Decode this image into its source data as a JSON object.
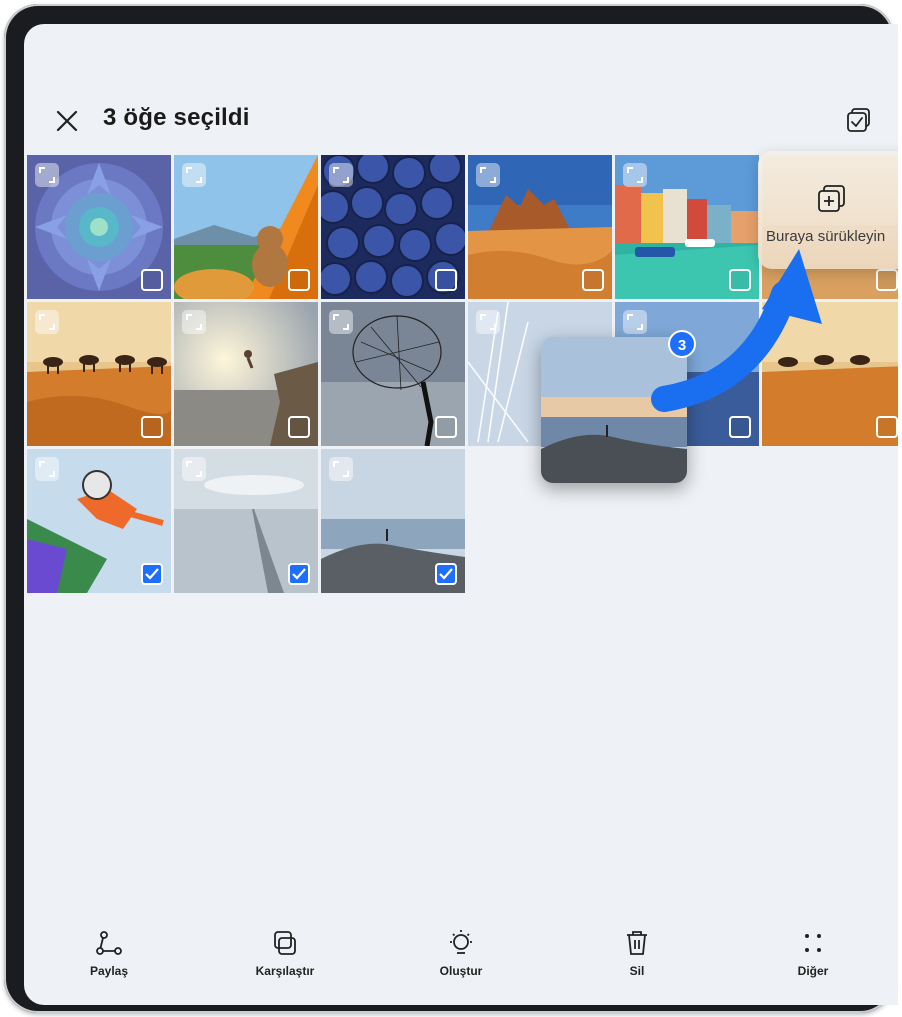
{
  "header": {
    "title": "3 öğe seçildi",
    "close_icon": "close-icon",
    "select_all_icon": "select-all-icon"
  },
  "grid": {
    "tiles": [
      {
        "name": "succulent-photo",
        "selected": false
      },
      {
        "name": "tent-teddy-photo",
        "selected": false
      },
      {
        "name": "blueberries-photo",
        "selected": false
      },
      {
        "name": "desert-rock-photo",
        "selected": false
      },
      {
        "name": "canal-houses-photo",
        "selected": false
      },
      {
        "name": "camel-caravan-photo",
        "selected": false
      },
      {
        "name": "cliff-jump-photo",
        "selected": false
      },
      {
        "name": "fishing-net-photo",
        "selected": false
      },
      {
        "name": "dandelion-photo",
        "selected": false
      },
      {
        "name": "dusk-coast-photo",
        "selected": false
      },
      {
        "name": "camel-caravan-2-photo",
        "selected": false
      },
      {
        "name": "skier-photo",
        "selected": true
      },
      {
        "name": "misty-bridge-photo",
        "selected": true
      },
      {
        "name": "coast-person-photo",
        "selected": true
      }
    ]
  },
  "drag": {
    "count": "3"
  },
  "drop_target": {
    "label": "Buraya sürükleyin",
    "icon": "add-to-album-icon"
  },
  "bottom_bar": {
    "share": "Paylaş",
    "compare": "Karşılaştır",
    "create": "Oluştur",
    "delete": "Sil",
    "more": "Diğer"
  },
  "colors": {
    "accent": "#1f6fff",
    "background": "#eef1f5"
  }
}
